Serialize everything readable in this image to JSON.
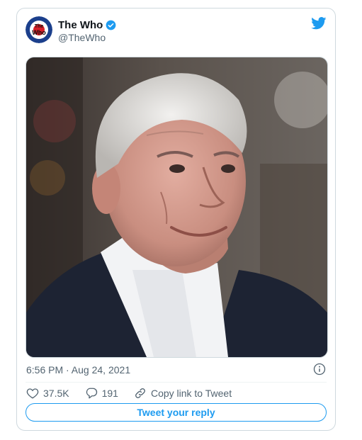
{
  "tweet": {
    "display_name": "The Who",
    "handle": "@TheWho",
    "timestamp": "6:56 PM · Aug 24, 2021",
    "avatar_text": "The Who"
  },
  "actions": {
    "likes": "37.5K",
    "replies": "191",
    "copy_link": "Copy link to Tweet"
  },
  "reply_button": "Tweet your reply",
  "colors": {
    "twitter_blue": "#1d9bf0",
    "text_secondary": "#536471",
    "border": "#cfd9de"
  },
  "icons": [
    "verified-badge-icon",
    "twitter-bird-icon",
    "info-icon",
    "heart-icon",
    "reply-icon",
    "link-icon"
  ]
}
